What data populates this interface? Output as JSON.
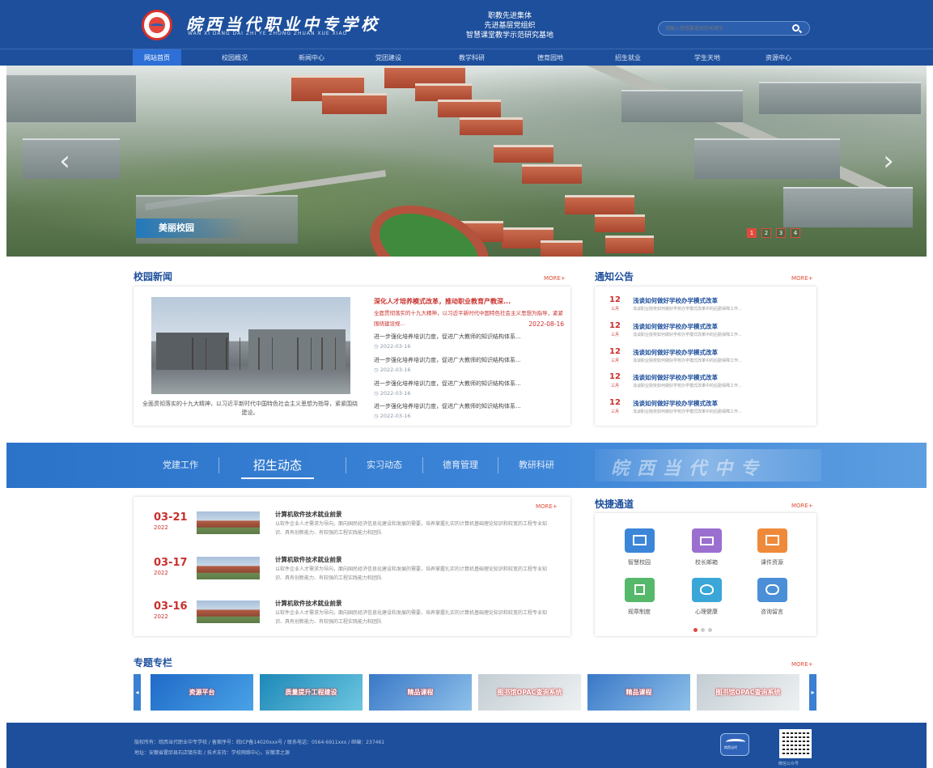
{
  "header": {
    "school_name": "皖西当代职业中专学校",
    "school_pinyin": "WAN XI DANG DAI ZHI YE ZHONG ZHUAN XUE XIAO",
    "slogan": [
      "职教先进集体",
      "先进基层党组织",
      "智慧课堂教学示范研究基地"
    ],
    "search_placeholder": "请输入您想要查找的关键字"
  },
  "nav": [
    "网站首页",
    "校园概况",
    "新闻中心",
    "党团建设",
    "教学科研",
    "德育园地",
    "招生就业",
    "学生天地",
    "资源中心"
  ],
  "banner": {
    "caption": "美丽校园",
    "pages": [
      "1",
      "2",
      "3",
      "4"
    ],
    "active_page": 1,
    "prev": "‹",
    "next": "›"
  },
  "campus_news": {
    "title": "校园新闻",
    "more": "MORE+",
    "photo_caption": "全面贯彻落实的十九大精神，以习近平新时代中国特色社会主义思想为指导，紧紧围绕建设。",
    "headline": "深化人才培养模式改革，推动职业教育产教深...",
    "headline_desc": "全面贯彻落实的十九大精神，以习近平新时代中国特色社会主义思想为指导，紧紧围绕建设规...",
    "headline_date": "2022-08-16",
    "items": [
      {
        "title": "进一步强化培养培训力度，促进广大教师的知识结构体系...",
        "date": "2022-03-16"
      },
      {
        "title": "进一步强化培养培训力度，促进广大教师的知识结构体系...",
        "date": "2022-03-16"
      },
      {
        "title": "进一步强化培养培训力度，促进广大教师的知识结构体系...",
        "date": "2022-03-16"
      },
      {
        "title": "进一步强化培养培训力度，促进广大教师的知识结构体系...",
        "date": "2022-03-16"
      }
    ]
  },
  "notice": {
    "title": "通知公告",
    "more": "MORE+",
    "items": [
      {
        "day": "12",
        "month": "三月",
        "title": "浅谈如何做好学校办学模式改革",
        "desc": "浅谈职业院校如何做好学校办学模式改革中的后勤保障工作..."
      },
      {
        "day": "12",
        "month": "三月",
        "title": "浅谈如何做好学校办学模式改革",
        "desc": "浅谈职业院校如何做好学校办学模式改革中的后勤保障工作..."
      },
      {
        "day": "12",
        "month": "三月",
        "title": "浅谈如何做好学校办学模式改革",
        "desc": "浅谈职业院校如何做好学校办学模式改革中的后勤保障工作..."
      },
      {
        "day": "12",
        "month": "三月",
        "title": "浅谈如何做好学校办学模式改革",
        "desc": "浅谈职业院校如何做好学校办学模式改革中的后勤保障工作..."
      },
      {
        "day": "12",
        "month": "三月",
        "title": "浅谈如何做好学校办学模式改革",
        "desc": "浅谈职业院校如何做好学校办学模式改革中的后勤保障工作..."
      }
    ]
  },
  "band": {
    "tabs": [
      "党建工作",
      "招生动态",
      "实习动态",
      "德育管理",
      "教研科研"
    ],
    "active_tab": 1,
    "deco_text": "皖西当代中专"
  },
  "admissions": {
    "more": "MORE+",
    "items": [
      {
        "md": "03-21",
        "year": "2022",
        "title": "计算机软件技术就业前景",
        "desc": "以软件企业人才需求为导向，面向国民经济信息化建设和发展的需要，培养掌握扎实的计算机基础理论知识和较宽的工程专业知识、具有创新能力、有较强的工程实践能力和团队"
      },
      {
        "md": "03-17",
        "year": "2022",
        "title": "计算机软件技术就业前景",
        "desc": "以软件企业人才需求为导向，面向国民经济信息化建设和发展的需要，培养掌握扎实的计算机基础理论知识和较宽的工程专业知识、具有创新能力、有较强的工程实践能力和团队"
      },
      {
        "md": "03-16",
        "year": "2022",
        "title": "计算机软件技术就业前景",
        "desc": "以软件企业人才需求为导向，面向国民经济信息化建设和发展的需要，培养掌握扎实的计算机基础理论知识和较宽的工程专业知识、具有创新能力、有较强的工程实践能力和团队"
      }
    ]
  },
  "quick_links": {
    "title": "快捷通道",
    "more": "MORE+",
    "items": [
      {
        "label": "智慧校园",
        "icon": "monitor-icon",
        "color": "#3b86d8"
      },
      {
        "label": "校长邮箱",
        "icon": "mail-icon",
        "color": "#9b6fd0"
      },
      {
        "label": "课件资源",
        "icon": "image-icon",
        "color": "#ef8a3a"
      },
      {
        "label": "规章制度",
        "icon": "book-icon",
        "color": "#55b86a"
      },
      {
        "label": "心理健康",
        "icon": "heartbeat-icon",
        "color": "#3ba6d8"
      },
      {
        "label": "咨询留言",
        "icon": "chat-icon",
        "color": "#4a8fd8"
      }
    ],
    "active_dot": 0
  },
  "special": {
    "title": "专题专栏",
    "more": "MORE+",
    "cards": [
      {
        "label": "资源平台",
        "bg": "#2a7fd6"
      },
      {
        "label": "质量提升工程建设",
        "bg": "#2f97c4"
      },
      {
        "label": "精品课程",
        "bg": "#4d8fd4"
      },
      {
        "label": "图书馆OPAC查询系统",
        "bg": "#c8d2d8"
      },
      {
        "label": "精品课程",
        "bg": "#4d8fd4"
      },
      {
        "label": "图书馆OPAC查询系统",
        "bg": "#c8d2d8"
      }
    ]
  },
  "footer": {
    "line1": "版权所有：皖西当代职业中专学校  /  备案序号：皖ICP备14020xxx号  /  联系电话：0564-6911xxx  /  邮编：237461",
    "line2": "地址：安徽省霍邱县石店镇东街  /  技术支持：学校网络中心，安徽清之源",
    "badge": "皖西当代",
    "qr_label": "微信公众号"
  }
}
